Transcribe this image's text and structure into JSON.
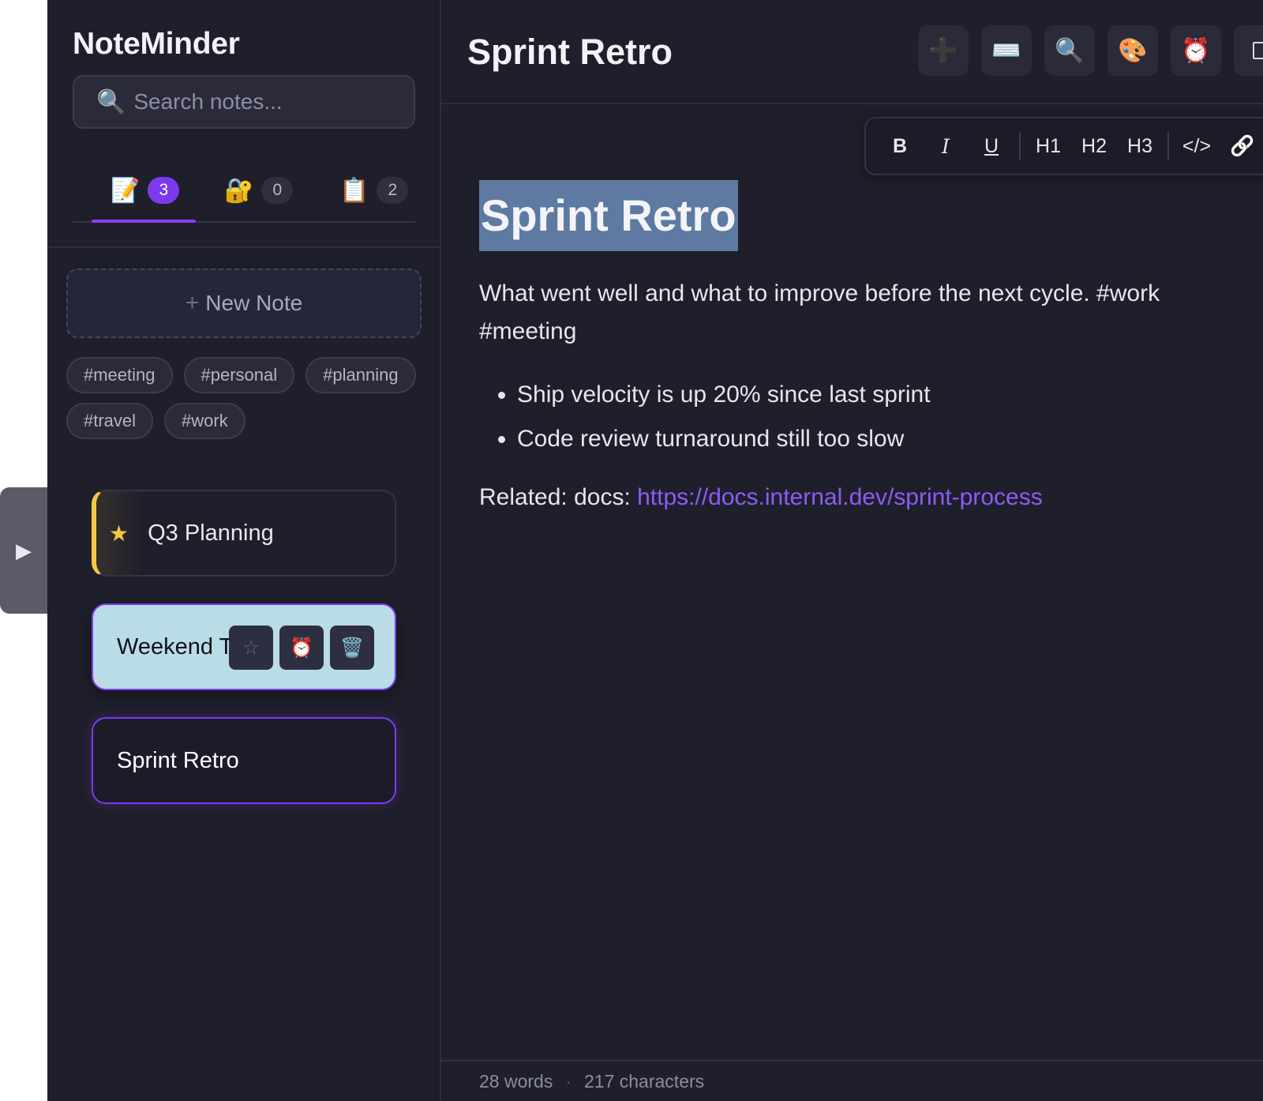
{
  "app": {
    "title": "NoteMinder"
  },
  "search": {
    "placeholder": "Search notes...",
    "icon": "magnifier-icon"
  },
  "tabs": [
    {
      "icon": "📝",
      "count": "3",
      "active": true
    },
    {
      "icon": "🔐",
      "count": "0",
      "active": false
    },
    {
      "icon": "📋",
      "count": "2",
      "active": false
    }
  ],
  "new_note": {
    "plus": "+",
    "label": "New Note"
  },
  "tags": [
    "#meeting",
    "#personal",
    "#planning",
    "#travel",
    "#work"
  ],
  "notes": [
    {
      "title": "Q3 Planning",
      "pinned": true,
      "star": "★"
    },
    {
      "title": "Weekend Trip",
      "hovered": true,
      "actions": [
        "☆",
        "⏰",
        "🗑️"
      ]
    },
    {
      "title": "Sprint Retro",
      "selected": true
    }
  ],
  "collapse_handle": {
    "glyph": "▶"
  },
  "header": {
    "title": "Sprint Retro",
    "toolbar": [
      {
        "name": "add-icon",
        "glyph": "➕"
      },
      {
        "name": "keyboard-icon",
        "glyph": "⌨️"
      },
      {
        "name": "search-icon",
        "glyph": "🔍"
      },
      {
        "name": "palette-icon",
        "glyph": "🎨"
      },
      {
        "name": "alarm-icon",
        "glyph": "⏰"
      },
      {
        "name": "square-icon",
        "glyph": "⬜"
      }
    ]
  },
  "format_bar": {
    "bold": "B",
    "italic": "I",
    "underline": "U",
    "h1": "H1",
    "h2": "H2",
    "h3": "H3",
    "code": "</>",
    "link": "🔗"
  },
  "document": {
    "title": "Sprint Retro",
    "paragraph": "What went well and what to improve before the next cycle. #work #meeting",
    "bullets": [
      "Ship velocity is up 20% since last sprint",
      "Code review turnaround still too slow"
    ],
    "related_prefix": "Related: docs: ",
    "related_link": "https://docs.internal.dev/sprint-process"
  },
  "status": {
    "words": "28 words",
    "separator": "·",
    "characters": "217 characters"
  },
  "colors": {
    "accent": "#7c3aed",
    "pinned_star": "#f5c842",
    "selection": "#5e7aa3",
    "hover_card": "#b9dce6",
    "link": "#8b5cf6"
  }
}
